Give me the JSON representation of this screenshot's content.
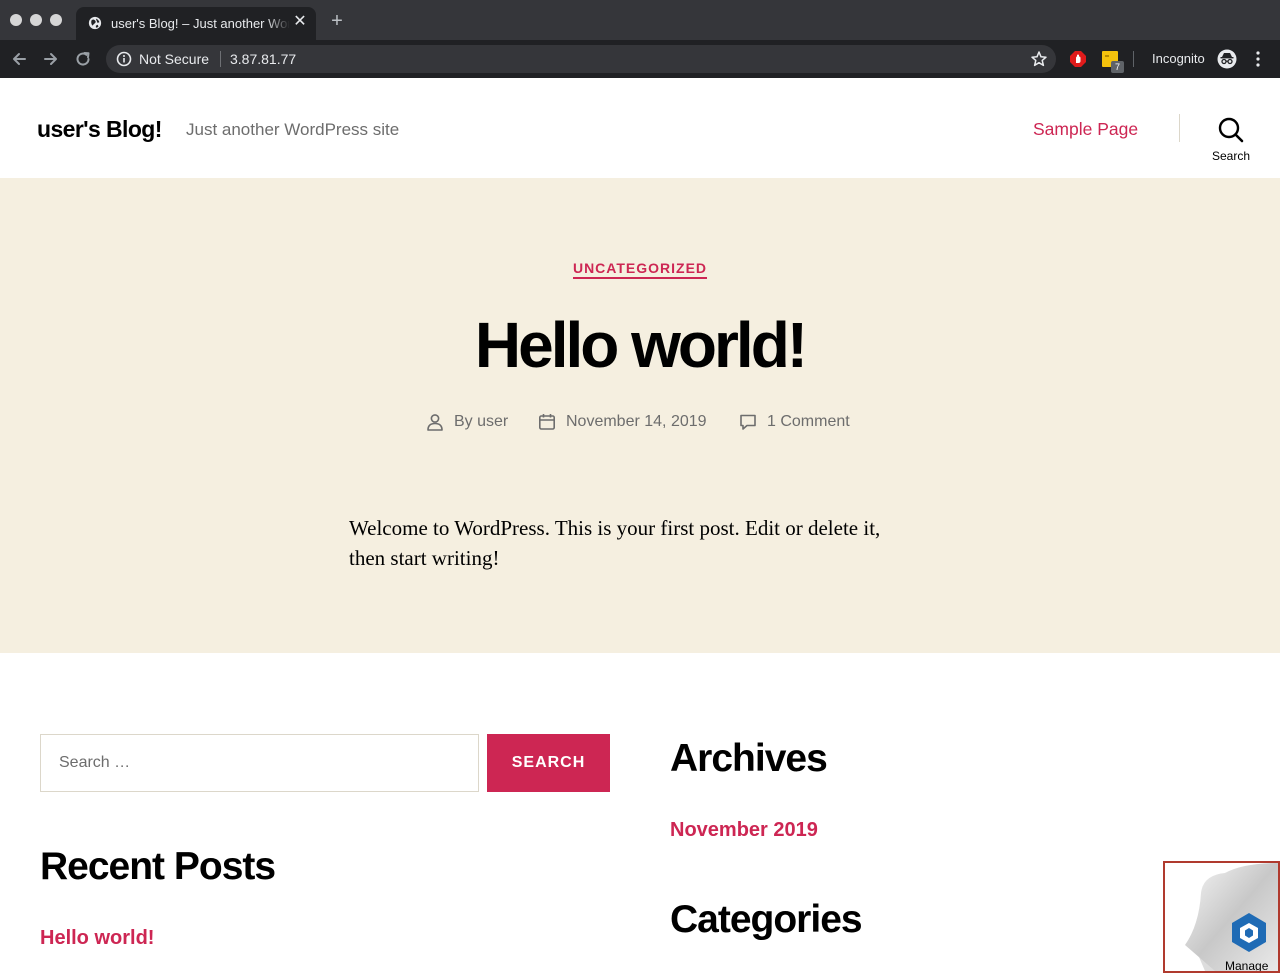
{
  "browser": {
    "tab_title": "user's Blog! – Just another WordPress site",
    "new_tab_symbol": "+",
    "close_symbol": "✕",
    "security_label": "Not Secure",
    "url": "3.87.81.77",
    "extension_badge": "7",
    "incognito_label": "Incognito",
    "icons": [
      "globe-icon",
      "back-arrow-icon",
      "forward-arrow-icon",
      "reload-icon",
      "info-icon",
      "star-icon",
      "adblock-icon",
      "sticky-note-icon",
      "incognito-icon",
      "kebab-menu-icon"
    ]
  },
  "site": {
    "title": "user's Blog!",
    "description": "Just another WordPress site",
    "nav": {
      "sample_page": "Sample Page"
    },
    "search_toggle_label": "Search"
  },
  "post": {
    "category": "UNCATEGORIZED",
    "title": "Hello world!",
    "author": "By user",
    "date": "November 14, 2019",
    "comments": "1 Comment",
    "content": "Welcome to WordPress. This is your first post. Edit or delete it, then start writing!"
  },
  "widgets": {
    "search": {
      "placeholder": "Search …",
      "value": "",
      "button": "SEARCH"
    },
    "recent_posts": {
      "title": "Recent Posts",
      "items": [
        "Hello world!"
      ]
    },
    "archives": {
      "title": "Archives",
      "items": [
        "November 2019"
      ]
    },
    "categories": {
      "title": "Categories"
    }
  },
  "overlay": {
    "label": "Manage"
  },
  "colors": {
    "accent": "#cd2653",
    "hero_bg": "#f5efe0",
    "chrome_dark": "#202124",
    "chrome_tabbar": "#35363a",
    "meta_text": "#6d6d6d"
  }
}
